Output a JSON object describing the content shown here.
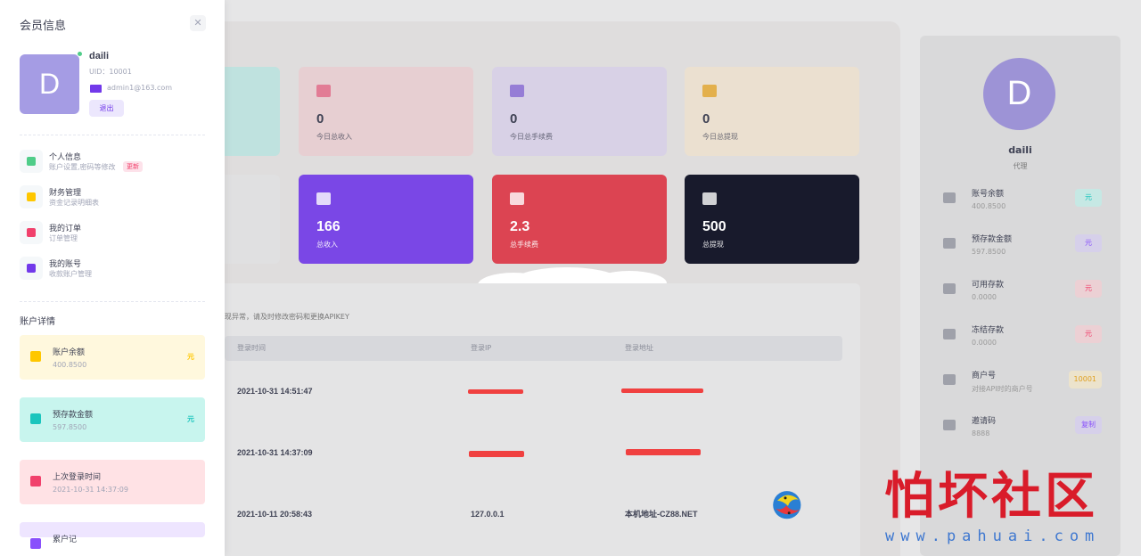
{
  "drawer": {
    "title": "会员信息",
    "profile": {
      "avatar_letter": "D",
      "name": "daili",
      "uid": "UID：10001",
      "email": "admin1@163.com",
      "logout": "退出"
    },
    "menu": [
      {
        "title": "个人信息",
        "subtitle": "账户设置,密码等修改",
        "badge": "更新",
        "color": "#50cd89"
      },
      {
        "title": "财务管理",
        "subtitle": "资金记录明细表",
        "color": "#ffc700"
      },
      {
        "title": "我的订单",
        "subtitle": "订单管理",
        "color": "#f1416c"
      },
      {
        "title": "我的账号",
        "subtitle": "收款账户管理",
        "color": "#7239ea"
      }
    ],
    "account_title": "账户详情",
    "account_cards": [
      {
        "title": "账户余额",
        "value": "400.8500",
        "unit": "元",
        "bg": "#fff8dd",
        "accent": "#ffc700"
      },
      {
        "title": "预存款金额",
        "value": "597.8500",
        "unit": "元",
        "bg": "#c8f5ee",
        "accent": "#1bc5bd"
      },
      {
        "title": "上次登录时间",
        "value": "2021-10-31 14:37:09",
        "unit": "",
        "bg": "#ffe2e5",
        "accent": "#f1416c"
      },
      {
        "title": "累户记",
        "value": "",
        "unit": "",
        "bg": "#eee5ff",
        "accent": "#8950fc"
      }
    ]
  },
  "stats_row1": [
    {
      "value": "0",
      "label": "今日总收入",
      "bg": "#e7cfd2",
      "icon_color": "#e06080"
    },
    {
      "value": "0",
      "label": "今日总手续费",
      "bg": "#d8d1e6",
      "icon_color": "#8060d0"
    },
    {
      "value": "0",
      "label": "今日总提现",
      "bg": "#ebe0d0",
      "icon_color": "#e0a020"
    }
  ],
  "stats_row2": [
    {
      "value": "166",
      "label": "总收入",
      "bg": "#7a47e6"
    },
    {
      "value": "2.3",
      "label": "总手续费",
      "bg": "#dc4452"
    },
    {
      "value": "500",
      "label": "总提现",
      "bg": "#181a2c"
    }
  ],
  "login_table": {
    "tip": "现异常，请及时修改密码和更换APIKEY",
    "headers": [
      "登录时间",
      "登录IP",
      "登录地址"
    ],
    "rows": [
      {
        "time": "2021-10-31 14:51:47",
        "ip": "",
        "address": ""
      },
      {
        "time": "2021-10-31 14:37:09",
        "ip": "",
        "address": ""
      },
      {
        "time": "2021-10-11 20:58:43",
        "ip": "127.0.0.1",
        "address": "本机地址-CZ88.NET"
      }
    ]
  },
  "right_profile": {
    "avatar_letter": "D",
    "name": "daili",
    "role": "代理",
    "items": [
      {
        "title": "账号余额",
        "value": "400.8500",
        "badge": "元",
        "badge_bg": "#c6e8e4",
        "badge_color": "#1bc5bd"
      },
      {
        "title": "预存款金额",
        "value": "597.8500",
        "badge": "元",
        "badge_bg": "#d6d0ea",
        "badge_color": "#8950fc"
      },
      {
        "title": "可用存款",
        "value": "0.0000",
        "badge": "元",
        "badge_bg": "#ecd0d4",
        "badge_color": "#f1416c"
      },
      {
        "title": "冻结存款",
        "value": "0.0000",
        "badge": "元",
        "badge_bg": "#ecd0d4",
        "badge_color": "#f1416c"
      },
      {
        "title": "商户号",
        "value": "对接API时的商户号",
        "badge": "10001",
        "badge_bg": "#ece3cc",
        "badge_color": "#e0a020"
      },
      {
        "title": "邀请码",
        "value": "8888",
        "badge": "复制",
        "badge_bg": "#d6d0ea",
        "badge_color": "#8950fc"
      }
    ]
  },
  "watermark": {
    "text": "怕坏社区",
    "url": "www.pahuai.com"
  }
}
